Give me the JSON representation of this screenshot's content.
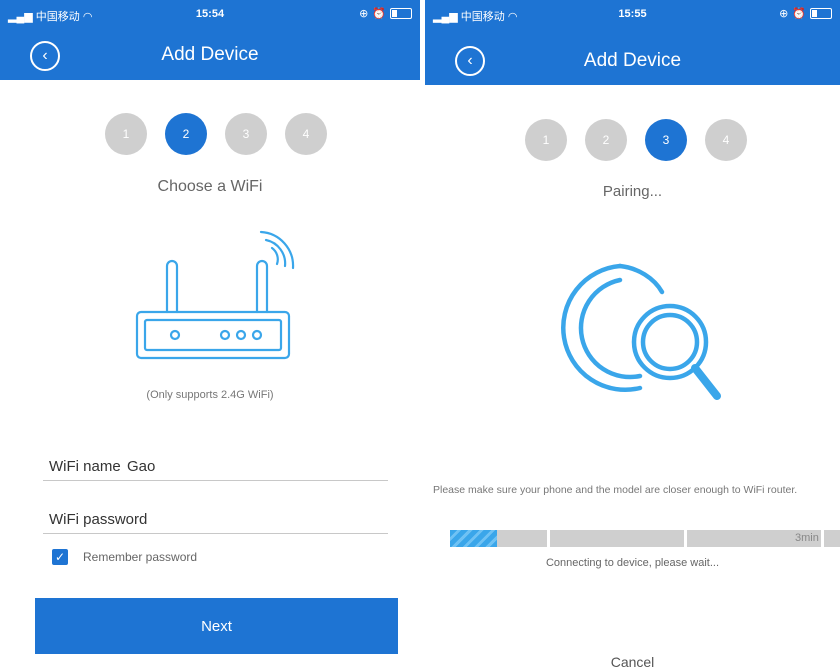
{
  "left_screen": {
    "status_bar": {
      "carrier": "中国移动",
      "time": "15:54"
    },
    "header": {
      "title": "Add Device",
      "back_icon": "back-arrow-icon"
    },
    "steps": [
      "1",
      "2",
      "3",
      "4"
    ],
    "active_step": 2,
    "subtitle": "Choose a WiFi",
    "router_icon": "wifi-router-icon",
    "note": "(Only supports 2.4G WiFi)",
    "wifi_name": {
      "label": "WiFi name",
      "value": "Gao"
    },
    "wifi_password": {
      "label": "WiFi password",
      "value": ""
    },
    "remember_password": {
      "label": "Remember password",
      "checked": true
    },
    "next_button": "Next"
  },
  "right_screen": {
    "status_bar": {
      "carrier": "中国移动",
      "time": "15:55"
    },
    "header": {
      "title": "Add Device",
      "back_icon": "back-arrow-icon"
    },
    "steps": [
      "1",
      "2",
      "3",
      "4"
    ],
    "active_step": 3,
    "subtitle": "Pairing...",
    "search_icon": "search-magnifier-icon",
    "hint": "Please make sure your phone and the model are closer enough to WiFi router.",
    "progress": {
      "fraction": 0.1,
      "timer": "3min"
    },
    "status_text": "Connecting to device, please wait...",
    "cancel_button": "Cancel"
  },
  "colors": {
    "primary": "#1e74d3",
    "inactive_step": "#cfcfcf",
    "accent_line": "#3aa6ea"
  }
}
